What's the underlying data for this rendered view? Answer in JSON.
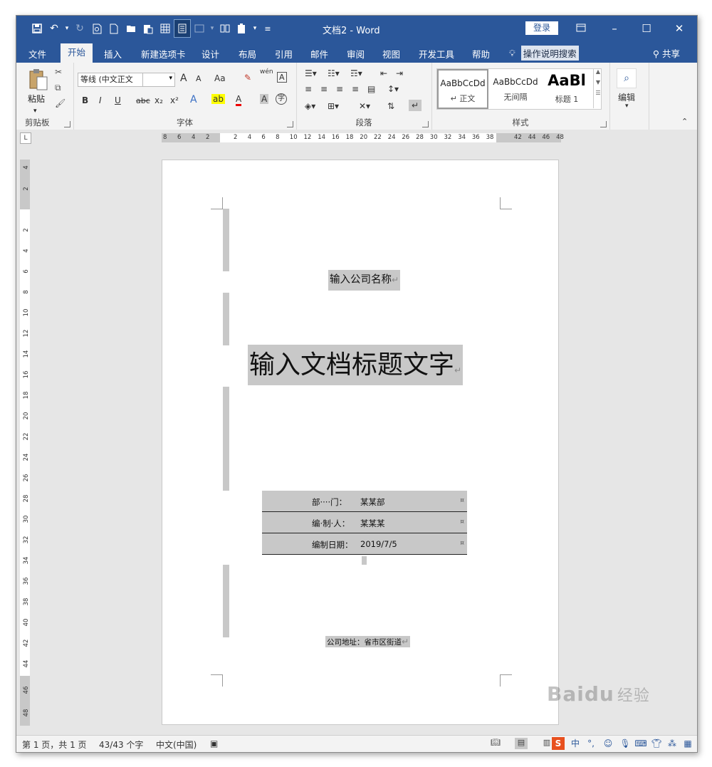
{
  "window": {
    "title": "文档2 - Word",
    "login": "登录"
  },
  "qat": {
    "icons": [
      "save-icon",
      "undo-icon",
      "redo-icon",
      "print-preview-icon",
      "new-doc-icon",
      "open-icon",
      "paste-special-icon",
      "grid-icon",
      "read-mode-icon",
      "image-icon",
      "columns-icon",
      "clipboard-icon",
      "customize-icon"
    ]
  },
  "tabs": [
    {
      "label": "文件"
    },
    {
      "label": "开始"
    },
    {
      "label": "插入"
    },
    {
      "label": "新建选项卡"
    },
    {
      "label": "设计"
    },
    {
      "label": "布局"
    },
    {
      "label": "引用"
    },
    {
      "label": "邮件"
    },
    {
      "label": "审阅"
    },
    {
      "label": "视图"
    },
    {
      "label": "开发工具"
    },
    {
      "label": "帮助"
    }
  ],
  "tell_me": "操作说明搜索",
  "share": "共享",
  "ribbon": {
    "clipboard": {
      "paste": "粘贴",
      "label": "剪贴板"
    },
    "font": {
      "name": "等线 (中文正文",
      "label": "字体",
      "grow": "A",
      "shrink": "A",
      "case": "Aa",
      "phonetic": "wén",
      "bold": "B",
      "italic": "I",
      "underline": "U",
      "strike": "abc",
      "sub": "x₂",
      "sup": "x²"
    },
    "paragraph": {
      "label": "段落"
    },
    "styles": {
      "label": "样式",
      "items": [
        {
          "preview": "AaBbCcDd",
          "name": "↵ 正文"
        },
        {
          "preview": "AaBbCcDd",
          "name": "无间隔"
        },
        {
          "preview": "AaBl",
          "name": "标题 1"
        }
      ]
    },
    "editing": {
      "label": "编辑"
    }
  },
  "ruler": {
    "h_left": [
      "8",
      "6",
      "4",
      "2"
    ],
    "h_right": [
      "2",
      "4",
      "6",
      "8",
      "10",
      "12",
      "14",
      "16",
      "18",
      "20",
      "22",
      "24",
      "26",
      "28",
      "30",
      "32",
      "34",
      "36",
      "38",
      "42",
      "44",
      "46",
      "48"
    ],
    "v_top": [
      "4",
      "2"
    ],
    "v_main": [
      "2",
      "4",
      "6",
      "8",
      "10",
      "12",
      "14",
      "16",
      "18",
      "20",
      "22",
      "24",
      "26",
      "28",
      "30",
      "32",
      "34",
      "36",
      "38",
      "40",
      "42",
      "44"
    ],
    "v_bottom": [
      "46",
      "48"
    ]
  },
  "document": {
    "company": "输入公司名称",
    "title": "输入文档标题文字",
    "rows": [
      {
        "label": "部····门：",
        "value": "某某部"
      },
      {
        "label": "编·制·人：",
        "value": "某某某"
      },
      {
        "label": "编制日期：",
        "value": "2019/7/5"
      }
    ],
    "address": "公司地址：省市区街道",
    "para_mark": "↵"
  },
  "status": {
    "page": "第 1 页，共 1 页",
    "words": "43/43 个字",
    "lang": "中文(中国)"
  },
  "watermark": {
    "brand": "Baidu",
    "sub": "经验"
  }
}
